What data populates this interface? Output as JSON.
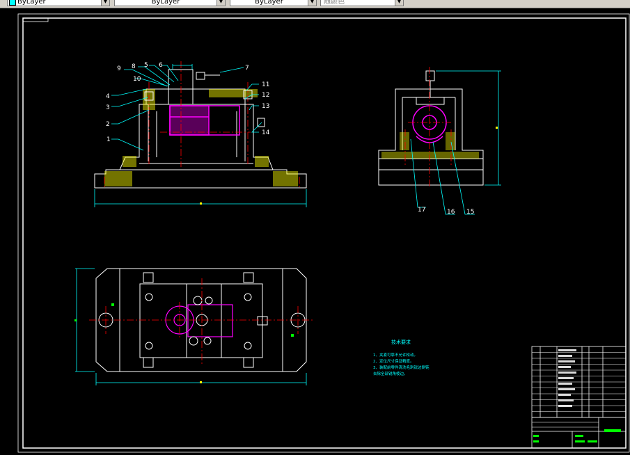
{
  "toolbar": {
    "color_value": "ByLayer",
    "linetype_value": "ByLayer",
    "lineweight_value": "ByLayer",
    "plotstyle_value": "随颜色"
  },
  "front_view": {
    "part_numbers": [
      "9",
      "8",
      "5",
      "6",
      "7",
      "10",
      "4",
      "3",
      "2",
      "1",
      "11",
      "12",
      "13",
      "14"
    ]
  },
  "side_view": {
    "part_numbers": [
      "17",
      "16",
      "15"
    ]
  },
  "tech_requirements": {
    "title": "技术要求",
    "lines": [
      "1、夹紧可靠不允许松动。",
      "2、定位尺寸保证精度。",
      "3、装配前零件清洗毛刺锐边倒钝",
      "去除全部锐角棱边。"
    ]
  },
  "colors": {
    "background": "#000000",
    "outline": "#ffffff",
    "dimension": "#00ffff",
    "centerline": "#ff0000",
    "workpiece": "#ff00ff",
    "hatch": "#ffff00",
    "title_fill": "#00ff00"
  }
}
